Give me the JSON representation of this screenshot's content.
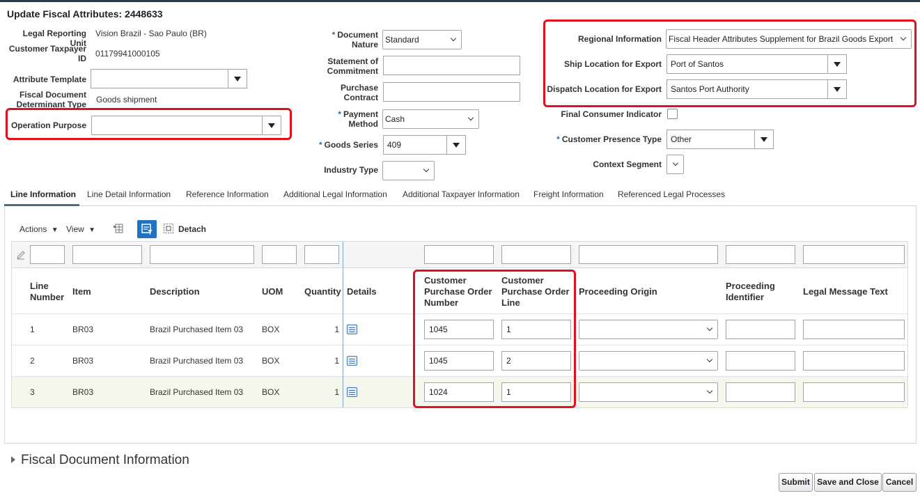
{
  "page": {
    "title": "Update Fiscal Attributes: 2448633"
  },
  "header": {
    "legal_reporting_unit": {
      "label": "Legal Reporting Unit",
      "value": "Vision Brazil - Sao Paulo (BR)"
    },
    "customer_taxpayer_id": {
      "label_line1": "Customer Taxpayer",
      "label_line2": "ID",
      "value": "01179941000105"
    },
    "attribute_template": {
      "label": "Attribute Template",
      "value": ""
    },
    "fiscal_document_determinant_type": {
      "label_line1": "Fiscal Document",
      "label_line2": "Determinant Type",
      "value": "Goods shipment"
    },
    "operation_purpose": {
      "label": "Operation Purpose",
      "value": ""
    },
    "document_nature": {
      "label_line1": "Document",
      "label_line2": "Nature",
      "value": "Standard"
    },
    "statement_of_commitment": {
      "label_line1": "Statement of",
      "label_line2": "Commitment",
      "value": ""
    },
    "purchase_contract": {
      "label_line1": "Purchase",
      "label_line2": "Contract",
      "value": ""
    },
    "payment_method": {
      "label_line1": "Payment",
      "label_line2": "Method",
      "value": "Cash"
    },
    "goods_series": {
      "label": "Goods Series",
      "value": "409"
    },
    "industry_type": {
      "label": "Industry Type",
      "value": ""
    },
    "regional_information": {
      "label": "Regional Information",
      "value": "Fiscal Header Attributes Supplement for Brazil Goods Export"
    },
    "ship_location_for_export": {
      "label": "Ship Location for Export",
      "value": "Port of Santos"
    },
    "dispatch_location_for_export": {
      "label": "Dispatch Location for Export",
      "value": "Santos Port Authority"
    },
    "final_consumer_indicator": {
      "label": "Final Consumer Indicator",
      "checked": false
    },
    "customer_presence_type": {
      "label": "Customer Presence Type",
      "value": "Other"
    },
    "context_segment": {
      "label": "Context Segment",
      "value": ""
    },
    "required_marker": "*"
  },
  "tabs": [
    {
      "label": "Line Information",
      "active": true
    },
    {
      "label": "Line Detail Information",
      "active": false
    },
    {
      "label": "Reference Information",
      "active": false
    },
    {
      "label": "Additional Legal Information",
      "active": false
    },
    {
      "label": "Additional Taxpayer Information",
      "active": false
    },
    {
      "label": "Freight Information",
      "active": false
    },
    {
      "label": "Referenced Legal Processes",
      "active": false
    }
  ],
  "toolbar": {
    "actions": "Actions",
    "view": "View",
    "detach": "Detach"
  },
  "table": {
    "columns": {
      "line_number": {
        "line1": "Line",
        "line2": "Number"
      },
      "item": "Item",
      "description": "Description",
      "uom": "UOM",
      "quantity": "Quantity",
      "details": "Details",
      "cpo_number": {
        "line1": "Customer",
        "line2": "Purchase Order",
        "line3": "Number"
      },
      "cpo_line": {
        "line1": "Customer",
        "line2": "Purchase Order",
        "line3": "Line"
      },
      "proceeding_origin": "Proceeding Origin",
      "proceeding_identifier": {
        "line1": "Proceeding",
        "line2": "Identifier"
      },
      "legal_message_text": "Legal Message Text"
    },
    "rows": [
      {
        "line": "1",
        "item": "BR03",
        "description": "Brazil Purchased Item 03",
        "uom": "BOX",
        "quantity": "1",
        "cpo_number": "1045",
        "cpo_line": "1",
        "proceeding_origin": "",
        "proceeding_identifier": "",
        "legal_message_text": ""
      },
      {
        "line": "2",
        "item": "BR03",
        "description": "Brazil Purchased Item 03",
        "uom": "BOX",
        "quantity": "1",
        "cpo_number": "1045",
        "cpo_line": "2",
        "proceeding_origin": "",
        "proceeding_identifier": "",
        "legal_message_text": ""
      },
      {
        "line": "3",
        "item": "BR03",
        "description": "Brazil Purchased Item 03",
        "uom": "BOX",
        "quantity": "1",
        "cpo_number": "1024",
        "cpo_line": "1",
        "proceeding_origin": "",
        "proceeding_identifier": "",
        "legal_message_text": ""
      }
    ]
  },
  "fiscal_document_section": {
    "label": "Fiscal Document Information"
  },
  "buttons": {
    "submit": "Submit",
    "save_and_close": "Save and Close",
    "cancel": "Cancel"
  },
  "colors": {
    "highlight": "#e0101f",
    "accent": "#2a6fb0",
    "selected_row": "#f5f7ec"
  }
}
